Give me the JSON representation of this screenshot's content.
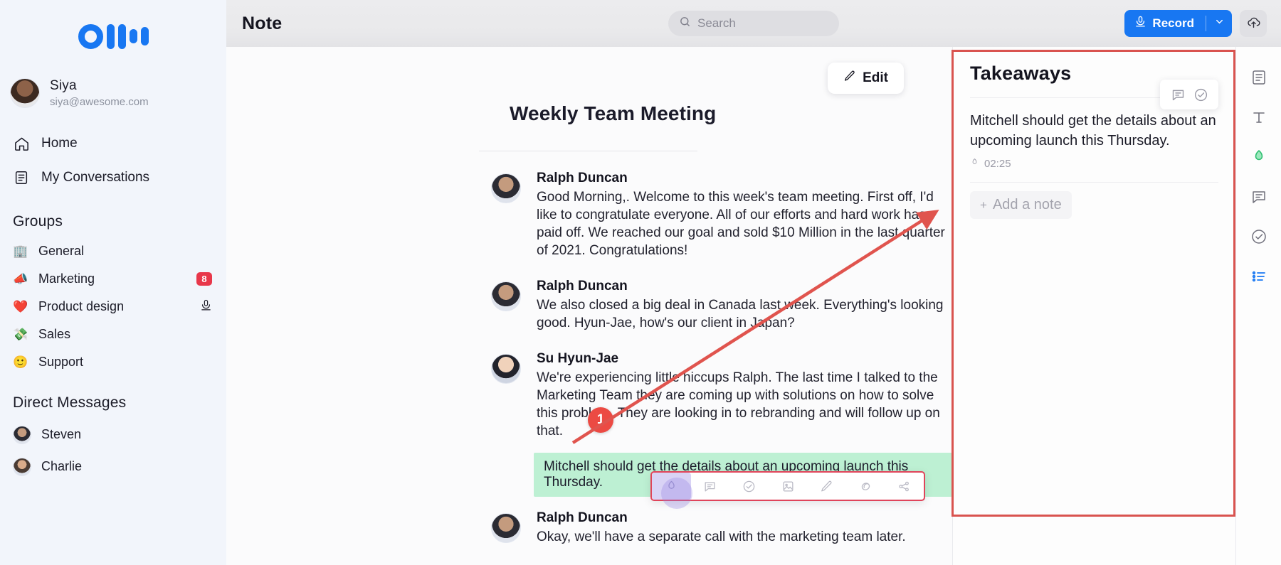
{
  "sidebar": {
    "logo_name": "otter-logo",
    "profile": {
      "name": "Siya",
      "email": "siya@awesome.com"
    },
    "nav": [
      {
        "label": "Home",
        "icon": "home-icon"
      },
      {
        "label": "My Conversations",
        "icon": "conversations-icon"
      }
    ],
    "groups_title": "Groups",
    "groups": [
      {
        "label": "General",
        "emoji": "🏢",
        "badge": ""
      },
      {
        "label": "Marketing",
        "emoji": "📣",
        "badge": "8"
      },
      {
        "label": "Product design",
        "emoji": "❤️",
        "badge": "",
        "trailing_icon": "mic-icon"
      },
      {
        "label": "Sales",
        "emoji": "💸",
        "badge": ""
      },
      {
        "label": "Support",
        "emoji": "🙂",
        "badge": ""
      }
    ],
    "dm_title": "Direct Messages",
    "dms": [
      {
        "label": "Steven"
      },
      {
        "label": "Charlie"
      }
    ]
  },
  "topbar": {
    "title": "Note",
    "search_placeholder": "Search",
    "search_icon": "search-icon",
    "record_label": "Record",
    "record_icon": "mic-icon",
    "record_caret_icon": "chevron-down-icon",
    "upload_icon": "cloud-upload-icon",
    "record_color": "#1877f2"
  },
  "document": {
    "edit_label": "Edit",
    "edit_icon": "pencil-icon",
    "title": "Weekly Team Meeting",
    "messages": [
      {
        "speaker": "Ralph Duncan",
        "text": "Good Morning,. Welcome to this week's team meeting. First off, I'd like to congratulate everyone. All of our efforts and hard work has paid off. We reached our goal and sold $10 Million in the last quarter of 2021. Congratulations!"
      },
      {
        "speaker": "Ralph Duncan",
        "text": "We also closed a big deal in Canada last week. Everything's looking good. Hyun-Jae, how's our client in Japan?"
      },
      {
        "speaker": "Su Hyun-Jae",
        "text": "We're experiencing little hiccups Ralph. The last time I talked to the Marketing Team they are coming up with solutions on how to solve this problem. They are looking in to rebranding and will follow up on that."
      },
      {
        "speaker": "Ralph Duncan",
        "text": "Okay, we'll have a separate call with the marketing team later."
      }
    ],
    "highlighted_text": "Mitchell should get the details about an upcoming launch this Thursday.",
    "highlight_color": "#bdf0d3"
  },
  "floating_toolbar": {
    "step_number": "1",
    "border_color": "#e0445a",
    "icons": [
      {
        "name": "highlighter-icon",
        "active": true
      },
      {
        "name": "comment-icon",
        "active": false
      },
      {
        "name": "check-circle-icon",
        "active": false
      },
      {
        "name": "image-icon",
        "active": false
      },
      {
        "name": "pencil-icon",
        "active": false
      },
      {
        "name": "eraser-icon",
        "active": false
      },
      {
        "name": "share-icon",
        "active": false
      }
    ]
  },
  "takeaways": {
    "title": "Takeaways",
    "hover_tools": [
      {
        "name": "comment-icon"
      },
      {
        "name": "check-circle-icon"
      }
    ],
    "note_text": "Mitchell should get the details about an upcoming launch this Thursday.",
    "timestamp": "02:25",
    "timestamp_icon": "highlighter-icon",
    "add_note_label": "Add a note",
    "add_note_plus": "+",
    "highlight_box_color": "#d9534f"
  },
  "right_rail": {
    "icons": [
      {
        "name": "transcript-icon",
        "color": "#6e6e7a"
      },
      {
        "name": "text-icon",
        "color": "#6e6e7a"
      },
      {
        "name": "highlighter-icon",
        "color": "#2fbf71"
      },
      {
        "name": "comment-icon",
        "color": "#6e6e7a"
      },
      {
        "name": "check-circle-icon",
        "color": "#6e6e7a"
      },
      {
        "name": "list-icon",
        "color": "#1877f2"
      }
    ]
  },
  "annotation": {
    "arrow_color": "#e0544e"
  }
}
